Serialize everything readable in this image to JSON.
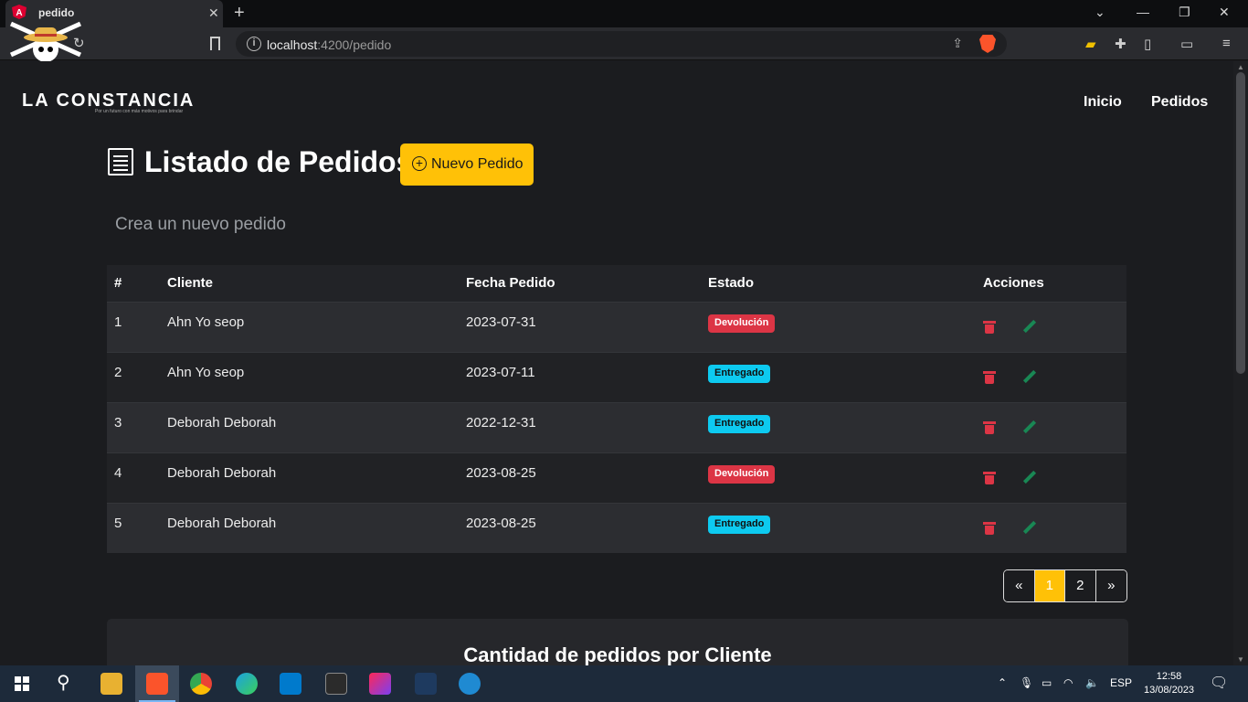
{
  "browser": {
    "tab_title": "pedido",
    "tab_close": "✕",
    "new_tab": "+",
    "url_host": "localhost",
    "url_path": ":4200/pedido",
    "controls": {
      "min": "—",
      "max": "❐",
      "close": "✕",
      "chevron": "⌄"
    }
  },
  "navbar": {
    "brand": "LA CONSTANCIA",
    "brand_tagline": "Por un futuro con más motivos para brindar",
    "links": [
      "Inicio",
      "Pedidos"
    ]
  },
  "main": {
    "title": "Listado de Pedidos",
    "new_button": "Nuevo Pedido",
    "subtitle": "Crea un nuevo pedido"
  },
  "table": {
    "headers": [
      "#",
      "Cliente",
      "Fecha Pedido",
      "Estado",
      "Acciones"
    ],
    "rows": [
      {
        "id": "1",
        "cliente": "Ahn Yo seop",
        "fecha": "2023-07-31",
        "estado": "Devolución",
        "estado_color": "#dc3545"
      },
      {
        "id": "2",
        "cliente": "Ahn Yo seop",
        "fecha": "2023-07-11",
        "estado": "Entregado",
        "estado_color": "#0dcaf0"
      },
      {
        "id": "3",
        "cliente": "Deborah Deborah",
        "fecha": "2022-12-31",
        "estado": "Entregado",
        "estado_color": "#0dcaf0"
      },
      {
        "id": "4",
        "cliente": "Deborah Deborah",
        "fecha": "2023-08-25",
        "estado": "Devolución",
        "estado_color": "#dc3545"
      },
      {
        "id": "5",
        "cliente": "Deborah Deborah",
        "fecha": "2023-08-25",
        "estado": "Entregado",
        "estado_color": "#0dcaf0"
      }
    ]
  },
  "pagination": {
    "prev": "«",
    "pages": [
      "1",
      "2"
    ],
    "active": "1",
    "next": "»"
  },
  "card": {
    "title": "Cantidad de pedidos por Cliente"
  },
  "taskbar": {
    "lang": "ESP",
    "time": "12:58",
    "date": "13/08/2023"
  },
  "colors": {
    "accent": "#ffc107",
    "danger": "#dc3545",
    "info": "#0dcaf0",
    "success": "#198754",
    "bg": "#1b1c1f"
  }
}
